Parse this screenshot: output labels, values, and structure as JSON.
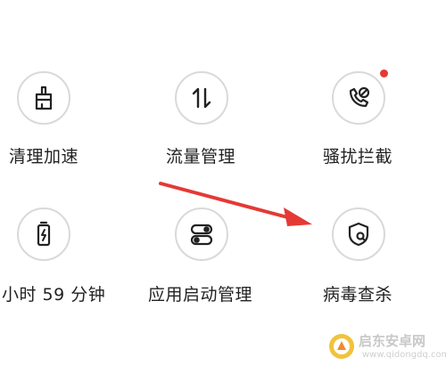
{
  "tiles": {
    "cleanup": {
      "label": "清理加速",
      "icon": "broom-icon"
    },
    "traffic": {
      "label": "流量管理",
      "icon": "up-down-arrows-icon"
    },
    "harassment": {
      "label": "骚扰拦截",
      "icon": "phone-block-icon",
      "badge": "red-dot"
    },
    "battery": {
      "label": "小时 59 分钟",
      "icon": "battery-charging-icon"
    },
    "startup": {
      "label": "应用启动管理",
      "icon": "toggle-switches-icon"
    },
    "virus": {
      "label": "病毒查杀",
      "icon": "shield-search-icon"
    }
  },
  "watermark": {
    "name": "启东安卓网",
    "url": "www.qidongdq.com"
  },
  "colors": {
    "icon_stroke": "#222222",
    "circle_border": "#d9d9d9",
    "badge": "#e53935",
    "arrow": "#e53935"
  }
}
